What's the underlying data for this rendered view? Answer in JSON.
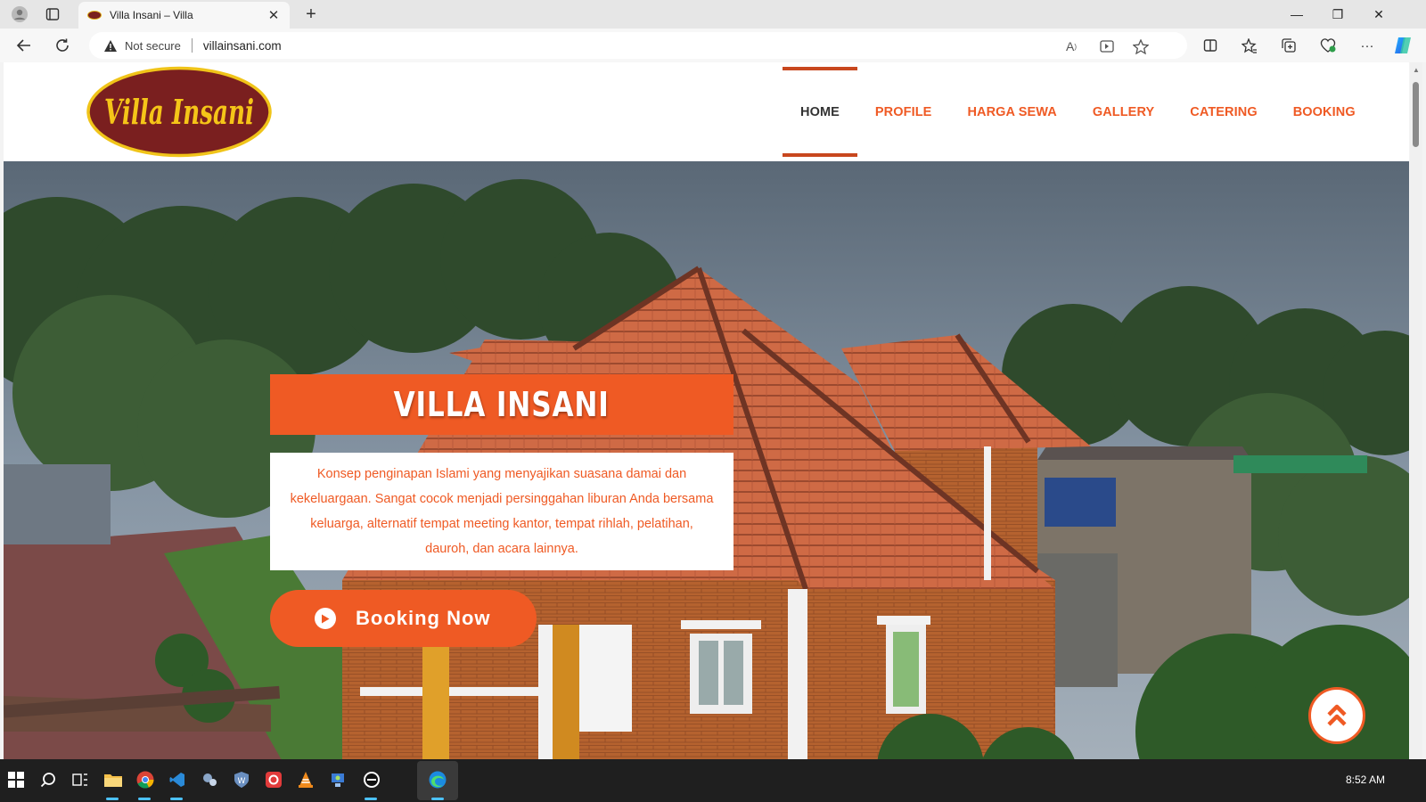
{
  "browser": {
    "tab_title": "Villa Insani – Villa",
    "security_label": "Not secure",
    "url": "villainsani.com"
  },
  "site": {
    "logo_text": "Villa Insani",
    "nav": [
      {
        "label": "HOME",
        "active": true
      },
      {
        "label": "PROFILE",
        "active": false
      },
      {
        "label": "HARGA SEWA",
        "active": false
      },
      {
        "label": "GALLERY",
        "active": false
      },
      {
        "label": "CATERING",
        "active": false
      },
      {
        "label": "BOOKING",
        "active": false
      }
    ]
  },
  "hero": {
    "title": "VILLA INSANI",
    "description": "Konsep penginapan Islami yang menyajikan suasana damai dan kekeluargaan. Sangat cocok menjadi persinggahan liburan Anda bersama keluarga, alternatif tempat meeting kantor, tempat rihlah, pelatihan, dauroh, dan acara lainnya.",
    "cta_label": "Booking Now"
  },
  "taskbar": {
    "time": "8:52 AM"
  },
  "colors": {
    "accent": "#ef5a24",
    "nav_active_bar": "#c8471e",
    "logo_bg": "#7a1f1f",
    "logo_text": "#f5c518"
  }
}
